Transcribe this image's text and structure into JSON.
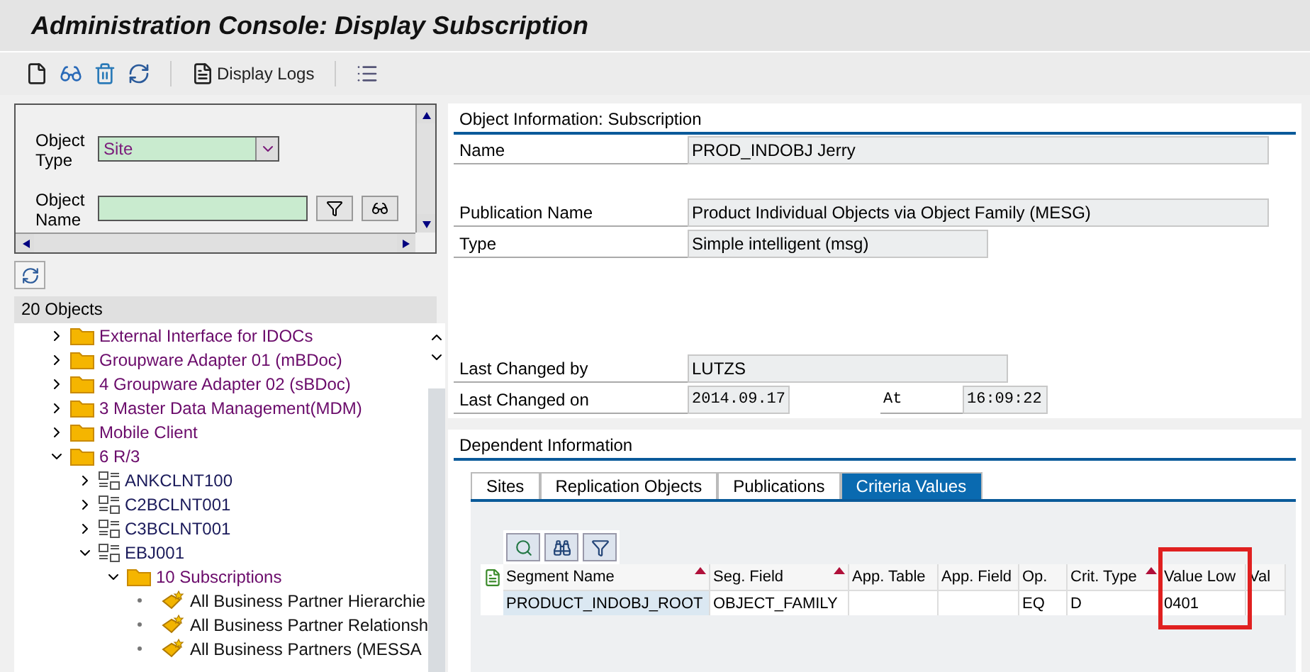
{
  "window": {
    "title": "Administration Console: Display Subscription"
  },
  "toolbar": {
    "display_logs": "Display Logs"
  },
  "selection": {
    "object_type_label": "Object Type",
    "object_type_value": "Site",
    "object_name_label": "Object Name"
  },
  "tree": {
    "header": "20 Objects",
    "items": [
      {
        "label": "External Interface for IDOCs",
        "kind": "folder",
        "expanded": false
      },
      {
        "label": "Groupware Adapter 01 (mBDoc)",
        "kind": "folder",
        "expanded": false
      },
      {
        "label": "4 Groupware Adapter 02 (sBDoc)",
        "kind": "folder",
        "expanded": false
      },
      {
        "label": "3 Master Data Management(MDM)",
        "kind": "folder",
        "expanded": false
      },
      {
        "label": "Mobile Client",
        "kind": "folder",
        "expanded": false
      },
      {
        "label": "6 R/3",
        "kind": "folder",
        "expanded": true,
        "children": [
          {
            "label": "ANKCLNT100",
            "kind": "system",
            "expanded": false
          },
          {
            "label": "C2BCLNT001",
            "kind": "system",
            "expanded": false
          },
          {
            "label": "C3BCLNT001",
            "kind": "system",
            "expanded": false
          },
          {
            "label": "EBJ001",
            "kind": "system",
            "expanded": true,
            "children": [
              {
                "label": "10 Subscriptions",
                "kind": "folder",
                "expanded": true,
                "children": [
                  {
                    "label": "All Business Partner Hierarchie",
                    "kind": "subscription"
                  },
                  {
                    "label": "All Business Partner Relationsh",
                    "kind": "subscription"
                  },
                  {
                    "label": "All Business Partners (MESSA",
                    "kind": "subscription"
                  }
                ]
              }
            ]
          }
        ]
      }
    ]
  },
  "object_info": {
    "title": "Object Information: Subscription",
    "fields": [
      {
        "label": "Name",
        "value": "PROD_INDOBJ Jerry",
        "kind": "wide"
      },
      {
        "kind": "gap"
      },
      {
        "label": "Publication Name",
        "value": "Product Individual Objects via Object Family (MESG)",
        "kind": "wide"
      },
      {
        "label": "Type",
        "value": "Simple intelligent (msg)",
        "kind": "medium"
      },
      {
        "kind": "biggap"
      },
      {
        "label": "Last Changed by",
        "value": "LUTZS",
        "kind": "medium2"
      },
      {
        "label": "Last Changed on",
        "value": "2014.09.17",
        "kind": "datetime",
        "at_label": "At",
        "at_value": "16:09:22"
      }
    ]
  },
  "dependent": {
    "title": "Dependent Information",
    "tabs": [
      {
        "label": "Sites",
        "selected": false
      },
      {
        "label": "Replication Objects",
        "selected": false
      },
      {
        "label": "Publications",
        "selected": false
      },
      {
        "label": "Criteria Values",
        "selected": true
      }
    ],
    "table": {
      "columns": [
        {
          "label": "Segment Name",
          "sorted": true
        },
        {
          "label": "Seg. Field",
          "sorted": true
        },
        {
          "label": "App. Table",
          "sorted": false
        },
        {
          "label": "App. Field",
          "sorted": false
        },
        {
          "label": "Op.",
          "sorted": false
        },
        {
          "label": "Crit. Type",
          "sorted": true
        },
        {
          "label": "Value Low",
          "sorted": false,
          "highlighted": true
        },
        {
          "label": "Val",
          "sorted": false
        }
      ],
      "rows": [
        [
          "PRODUCT_INDOBJ_ROOT",
          "OBJECT_FAMILY",
          "",
          "",
          "EQ",
          "D",
          "0401",
          ""
        ]
      ]
    }
  }
}
